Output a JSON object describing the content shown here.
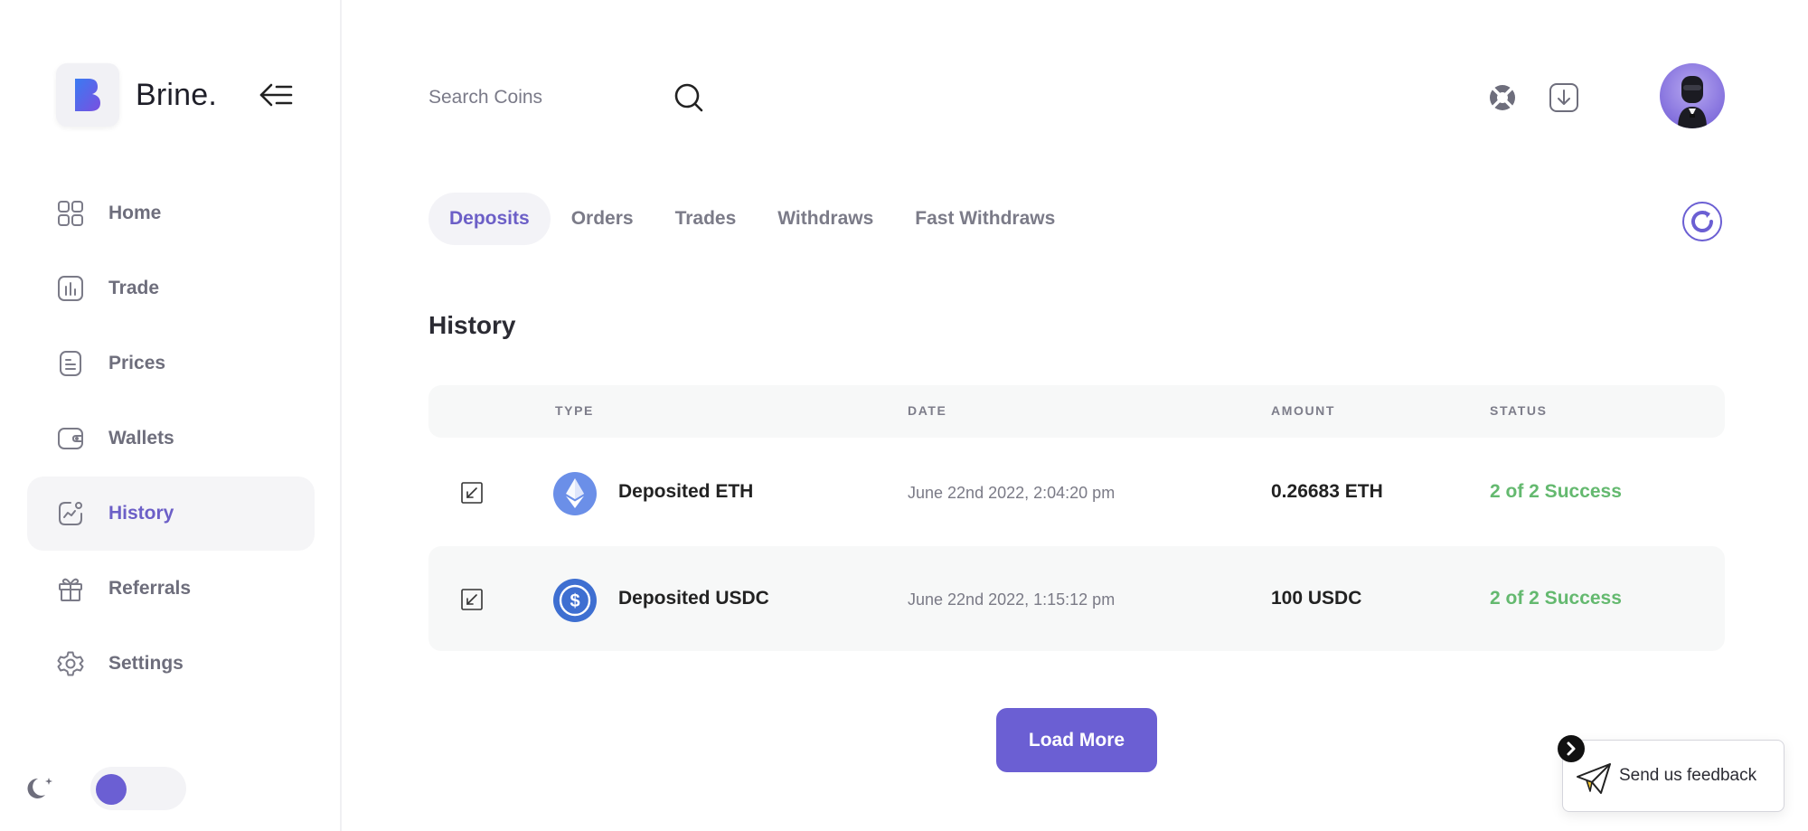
{
  "brand": {
    "name": "Brine.",
    "logo_letter": "B"
  },
  "sidebar": {
    "items": [
      {
        "label": "Home",
        "icon": "grid-icon"
      },
      {
        "label": "Trade",
        "icon": "chart-bars-icon"
      },
      {
        "label": "Prices",
        "icon": "document-icon"
      },
      {
        "label": "Wallets",
        "icon": "wallet-icon"
      },
      {
        "label": "History",
        "icon": "history-chart-icon",
        "active": true
      },
      {
        "label": "Referrals",
        "icon": "gift-icon"
      },
      {
        "label": "Settings",
        "icon": "gear-icon"
      }
    ],
    "dark_mode_on": false
  },
  "header": {
    "search_placeholder": "Search Coins"
  },
  "tabs": [
    {
      "label": "Deposits",
      "active": true
    },
    {
      "label": "Orders"
    },
    {
      "label": "Trades"
    },
    {
      "label": "Withdraws"
    },
    {
      "label": "Fast Withdraws"
    }
  ],
  "history": {
    "title": "History",
    "columns": {
      "type": "TYPE",
      "date": "DATE",
      "amount": "AMOUNT",
      "status": "STATUS"
    },
    "rows": [
      {
        "type": "Deposited ETH",
        "coin": "eth-coin-icon",
        "date": "June 22nd 2022, 2:04:20 pm",
        "amount": "0.26683 ETH",
        "status": "2 of 2 Success"
      },
      {
        "type": "Deposited USDC",
        "coin": "usdc-coin-icon",
        "date": "June 22nd 2022, 1:15:12 pm",
        "amount": "100 USDC",
        "status": "2 of 2 Success"
      }
    ],
    "load_more_label": "Load More"
  },
  "feedback": {
    "label": "Send us feedback"
  },
  "colors": {
    "accent": "#6b5fd3",
    "success": "#64b96f",
    "muted": "#7b7b88"
  }
}
